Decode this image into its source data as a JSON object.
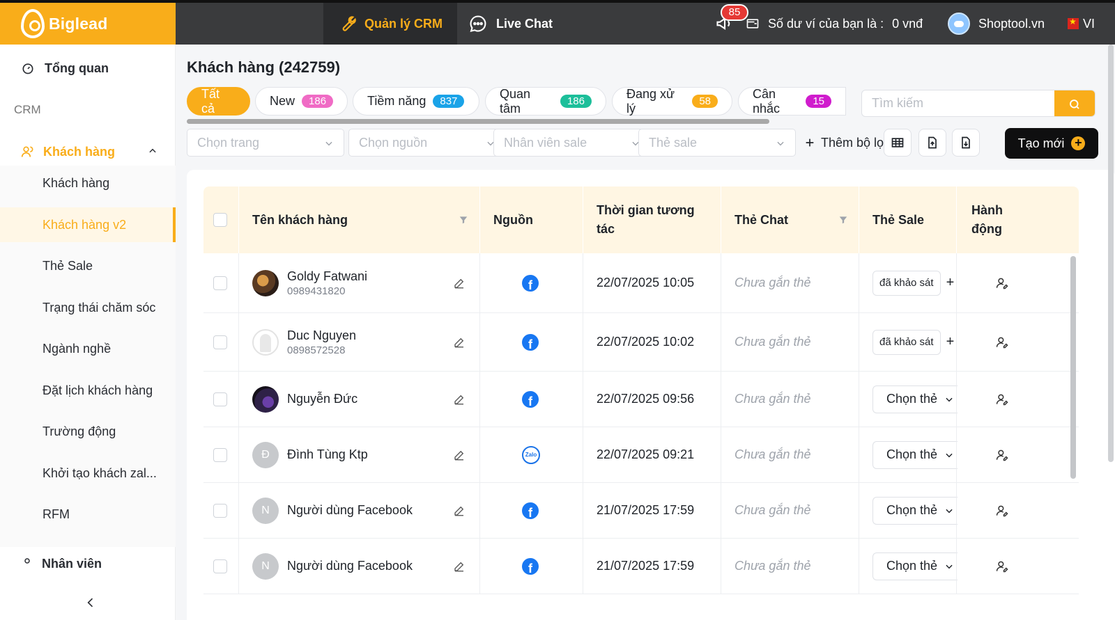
{
  "brand": {
    "name": "Biglead"
  },
  "topnav": {
    "crm_tab": "Quản lý CRM",
    "chat_tab": "Live Chat",
    "notifications": "85",
    "wallet_text": "Số dư ví của bạn là :",
    "wallet_value": "0 vnđ",
    "shop_name": "Shoptool.vn",
    "lang": "VI"
  },
  "sidebar": {
    "overview": "Tổng quan",
    "section": "CRM",
    "group": "Khách hàng",
    "items": [
      "Khách hàng",
      "Khách hàng v2",
      "Thẻ Sale",
      "Trạng thái chăm sóc",
      "Ngành nghề",
      "Đặt lịch khách hàng",
      "Trường động",
      "Khởi tạo khách zal...",
      "RFM"
    ],
    "next_group": "Nhân viên"
  },
  "page": {
    "title": "Khách hàng (242759)",
    "tabs": [
      {
        "label": "Tất cả",
        "count": ""
      },
      {
        "label": "New",
        "count": "186"
      },
      {
        "label": "Tiềm năng",
        "count": "837"
      },
      {
        "label": "Quan tâm",
        "count": "186"
      },
      {
        "label": "Đang xử lý",
        "count": "58"
      },
      {
        "label": "Cân nhắc",
        "count": "15"
      }
    ],
    "search_placeholder": "Tìm kiếm",
    "filters": [
      "Chọn trang",
      "Chọn nguồn",
      "Nhân viên sale",
      "Thẻ sale"
    ],
    "add_filter": "Thêm bộ lọc",
    "create": "Tạo mới"
  },
  "table": {
    "headers": {
      "name": "Tên khách hàng",
      "source": "Nguồn",
      "time_line1": "Thời gian tương",
      "time_line2": "tác",
      "chat_tag": "Thẻ Chat",
      "sale_tag": "Thẻ Sale",
      "action_line1": "Hành",
      "action_line2": "động"
    },
    "rows": [
      {
        "name": "Goldy Fatwani",
        "phone": "0989431820",
        "source": "facebook",
        "time": "22/07/2025 10:05",
        "chat_tag": "Chưa gắn thẻ",
        "sale_tag": "đã khảo sát"
      },
      {
        "name": "Duc Nguyen",
        "phone": "0898572528",
        "source": "facebook",
        "time": "22/07/2025 10:02",
        "chat_tag": "Chưa gắn thẻ",
        "sale_tag": "đã khảo sát"
      },
      {
        "name": "Nguyễn Đức",
        "phone": "",
        "source": "facebook",
        "time": "22/07/2025 09:56",
        "chat_tag": "Chưa gắn thẻ",
        "sale_tag": "Chọn thẻ"
      },
      {
        "name": "Đình Tùng Ktp",
        "phone": "",
        "source": "zalo",
        "time": "22/07/2025 09:21",
        "chat_tag": "Chưa gắn thẻ",
        "sale_tag": "Chọn thẻ",
        "initial": "Đ"
      },
      {
        "name": "Người dùng Facebook",
        "phone": "",
        "source": "facebook",
        "time": "21/07/2025 17:59",
        "chat_tag": "Chưa gắn thẻ",
        "sale_tag": "Chọn thẻ",
        "initial": "N"
      },
      {
        "name": "Người dùng Facebook",
        "phone": "",
        "source": "facebook",
        "time": "21/07/2025 17:59",
        "chat_tag": "Chưa gắn thẻ",
        "sale_tag": "Chọn thẻ",
        "initial": "N"
      }
    ]
  },
  "colors": {
    "accent": "#f9ad1a",
    "topbar": "#3a3b3d",
    "header_bg": "#fff6e3",
    "new": "#f06bc5",
    "tiem_nang": "#1aa3e8",
    "quan_tam": "#1cbf9a",
    "dang_xu_ly": "#f9ad1a",
    "can_nhac": "#d01ccd"
  },
  "icons": {
    "zalo_text": "Zalo",
    "facebook_glyph": "f"
  }
}
